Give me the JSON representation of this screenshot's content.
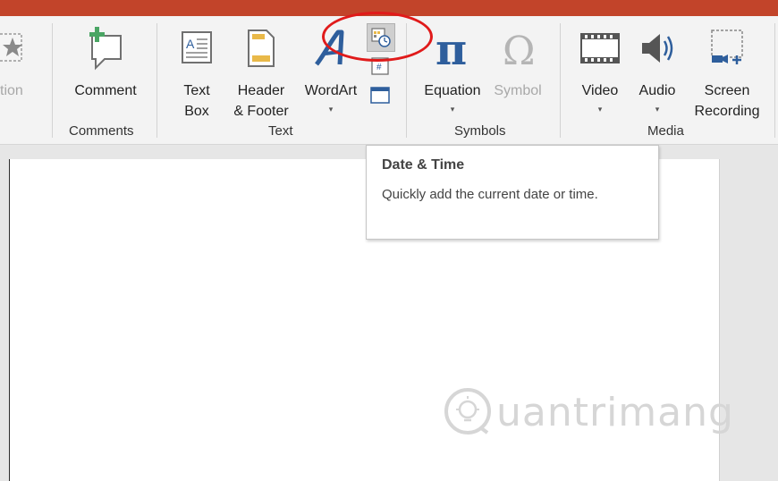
{
  "ribbon": {
    "partial_left_label": "tion",
    "comments_group": {
      "label": "Comments",
      "comment_button": "Comment"
    },
    "text_group": {
      "label": "Text",
      "text_box_line1": "Text",
      "text_box_line2": "Box",
      "header_footer_line1": "Header",
      "header_footer_line2": "& Footer",
      "wordart": "WordArt",
      "caret": "▾"
    },
    "symbols_group": {
      "label": "Symbols",
      "equation": "Equation",
      "symbol": "Symbol",
      "caret": "▾"
    },
    "media_group": {
      "label": "Media",
      "video": "Video",
      "audio": "Audio",
      "screen_recording_line1": "Screen",
      "screen_recording_line2": "Recording",
      "caret": "▾"
    }
  },
  "tooltip": {
    "title": "Date & Time",
    "description": "Quickly add the current date or time."
  },
  "watermark": {
    "text": "uantrimang"
  },
  "colors": {
    "title_bar": "#c2442a",
    "highlight_ellipse": "#e01a1a",
    "accent_blue": "#2e5e9c",
    "accent_green": "#4aa564",
    "accent_gold": "#e9b949"
  },
  "icons": {
    "star_partial": "star-icon",
    "comment": "comment-add-icon",
    "text_box": "text-box-icon",
    "header_footer": "header-footer-icon",
    "wordart": "wordart-icon",
    "date_time": "date-time-icon",
    "slide_number": "slide-number-icon",
    "object": "object-icon",
    "equation": "pi-icon",
    "symbol": "omega-icon",
    "video": "film-icon",
    "audio": "speaker-icon",
    "screen_recording": "screen-recording-icon"
  }
}
